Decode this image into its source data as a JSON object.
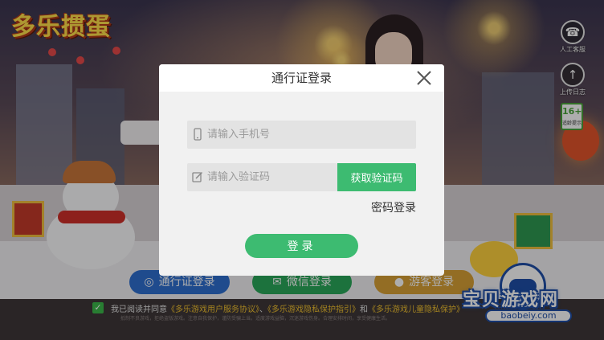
{
  "background": {
    "logo_text": "多乐掼蛋",
    "side_buttons": [
      {
        "label": "人工客服",
        "icon": "headset-icon",
        "glyph": "☎"
      },
      {
        "label": "上传日志",
        "icon": "upload-icon",
        "glyph": "↑"
      }
    ],
    "age_badge": {
      "num": "16+",
      "tip": "适龄提示"
    },
    "login_buttons": [
      {
        "label": "通行证登录",
        "icon": "passport-icon",
        "glyph": "◎"
      },
      {
        "label": "微信登录",
        "icon": "wechat-icon",
        "glyph": "✉"
      },
      {
        "label": "游客登录",
        "icon": "guest-icon",
        "glyph": "●"
      }
    ],
    "agreement": {
      "checkbox_glyph": "✓",
      "prefix": "我已阅读并同意",
      "link1": "《多乐游戏用户服务协议》",
      "sep": "、",
      "link2": "《多乐游戏隐私保护指引》",
      "and": "和",
      "link3": "《多乐游戏儿童隐私保护》"
    },
    "fine_print": "抵制不良游戏，拒绝盗版游戏。注意自我保护，谨防受骗上当。适度游戏益脑，沉迷游戏伤身。合理安排时间，享受健康生活。"
  },
  "watermark": {
    "title": "宝贝游戏网",
    "url": "baobeiy.com"
  },
  "dialog": {
    "title": "通行证登录",
    "phone_placeholder": "请输入手机号",
    "code_placeholder": "请输入验证码",
    "get_code_label": "获取验证码",
    "password_login_label": "密码登录",
    "login_label": "登录"
  },
  "colors": {
    "accent_green": "#3dbb71",
    "dialog_bg": "#f1f1f1",
    "field_bg": "#e3e3e3",
    "passport_blue": "#2f6fd0",
    "wechat_green": "#2aa85a",
    "guest_gold": "#d9a135"
  }
}
